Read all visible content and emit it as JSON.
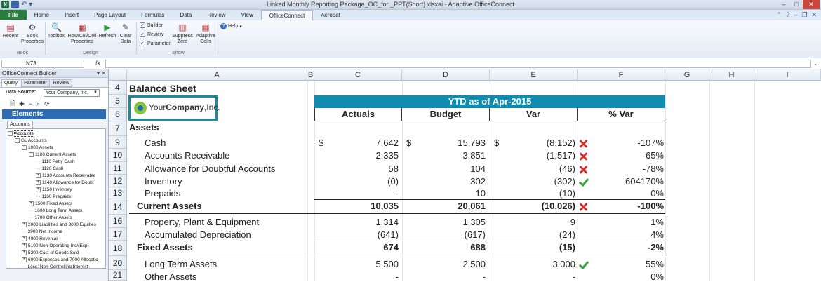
{
  "window": {
    "title": "Linked  Monthly Reporting Package_OC_for _PPT(Short).xlsxai - Adaptive OfficeConnect",
    "controls": [
      "–",
      "□",
      "✕"
    ]
  },
  "ribbon": {
    "tabs": [
      "File",
      "Home",
      "Insert",
      "Page Layout",
      "Formulas",
      "Data",
      "Review",
      "View",
      "OfficeConnect",
      "Acrobat"
    ],
    "active_tab": "OfficeConnect",
    "buttons": {
      "recent": "Recent",
      "book_properties": "Book Properties",
      "toolbox": "Toolbox",
      "rowcolcell": "Row/Col/Cell Properties",
      "refresh": "Refresh",
      "clear_data": "Clear Data",
      "suppress_zero": "Suppress Zero",
      "adaptive_cells": "Adaptive Cells",
      "help": "Help"
    },
    "checkboxes": {
      "builder": "Builder",
      "review": "Review",
      "parameter": "Parameter"
    },
    "groups": {
      "book": "Book",
      "design": "Design",
      "show": "Show"
    }
  },
  "formula_bar": {
    "name_box": "N73",
    "fx": "fx",
    "formula": ""
  },
  "pane": {
    "title": "OfficeConnect Builder",
    "tabs": [
      "Query",
      "Parameter",
      "Review"
    ],
    "data_source_label": "Data Source:",
    "data_source_value": "Your Company, Inc.",
    "elements_title": "Elements",
    "accounts_tab": "Accounts",
    "tree": [
      {
        "label": "Accounts",
        "level": 0,
        "toggle": "−"
      },
      {
        "label": "GL Accounts",
        "level": 1,
        "toggle": "−"
      },
      {
        "label": "1000 Assets",
        "level": 2,
        "toggle": "−"
      },
      {
        "label": "1100 Current Assets",
        "level": 3,
        "toggle": "−"
      },
      {
        "label": "1110 Petty Cash",
        "level": 4,
        "toggle": ""
      },
      {
        "label": "1120 Cash",
        "level": 4,
        "toggle": ""
      },
      {
        "label": "1130 Accounts Receivable",
        "level": 4,
        "toggle": "+"
      },
      {
        "label": "1140 Allowance for Doubt",
        "level": 4,
        "toggle": "+"
      },
      {
        "label": "1150 Inventory",
        "level": 4,
        "toggle": "+"
      },
      {
        "label": "1160 Prepaids",
        "level": 4,
        "toggle": ""
      },
      {
        "label": "1500 Fixed Assets",
        "level": 3,
        "toggle": "+"
      },
      {
        "label": "1600 Long Term Assets",
        "level": 3,
        "toggle": ""
      },
      {
        "label": "1700 Other Assets",
        "level": 3,
        "toggle": ""
      },
      {
        "label": "2000 Liabilities and 3000 Equities",
        "level": 2,
        "toggle": "+"
      },
      {
        "label": "3900 Net Income",
        "level": 2,
        "toggle": ""
      },
      {
        "label": "4000 Revenue",
        "level": 2,
        "toggle": "+"
      },
      {
        "label": "5100 Non-Operating Inc/(Exp)",
        "level": 2,
        "toggle": "+"
      },
      {
        "label": "5200 Cost of Goods Sold",
        "level": 2,
        "toggle": "+"
      },
      {
        "label": "6000 Expenses and 7000 Allocatic",
        "level": 2,
        "toggle": "+"
      },
      {
        "label": "Less: Non-Controlling Interest",
        "level": 2,
        "toggle": ""
      }
    ]
  },
  "sheet": {
    "columns": [
      "A",
      "B",
      "C",
      "D",
      "E",
      "F",
      "G",
      "H",
      "I"
    ],
    "rows": [
      "4",
      "5",
      "6",
      "7",
      "9",
      "10",
      "11",
      "12",
      "13",
      "14",
      "16",
      "17",
      "18",
      "20",
      "21"
    ],
    "title": "Balance Sheet",
    "logo_text_prefix": "Your",
    "logo_text_bold": "Company",
    "logo_text_suffix": ",Inc.",
    "period_header": "YTD as of Apr-2015",
    "col_headers": {
      "actuals": "Actuals",
      "budget": "Budget",
      "var": "Var",
      "pct_var": "% Var"
    },
    "section_assets": "Assets",
    "currency": "$",
    "lines": [
      {
        "label": "Cash",
        "actuals": "7,642",
        "budget": "15,793",
        "var": "(8,152)",
        "pct": "-107%",
        "flag": "x",
        "dollar": true
      },
      {
        "label": "Accounts Receivable",
        "actuals": "2,335",
        "budget": "3,851",
        "var": "(1,517)",
        "pct": "-65%",
        "flag": "x"
      },
      {
        "label": "Allowance for Doubtful Accounts",
        "actuals": "58",
        "budget": "104",
        "var": "(46)",
        "pct": "-78%",
        "flag": "x"
      },
      {
        "label": "Inventory",
        "actuals": "(0)",
        "budget": "302",
        "var": "(302)",
        "pct": "604170%",
        "flag": "check"
      },
      {
        "label": "Prepaids",
        "actuals": "-",
        "budget": "10",
        "var": "(10)",
        "pct": "0%",
        "flag": ""
      },
      {
        "label": "Current Assets",
        "actuals": "10,035",
        "budget": "20,061",
        "var": "(10,026)",
        "pct": "-100%",
        "flag": "x",
        "total": true
      },
      {
        "label": "Property, Plant & Equipment",
        "actuals": "1,314",
        "budget": "1,305",
        "var": "9",
        "pct": "1%",
        "flag": ""
      },
      {
        "label": "Accumulated Depreciation",
        "actuals": "(641)",
        "budget": "(617)",
        "var": "(24)",
        "pct": "4%",
        "flag": ""
      },
      {
        "label": "Fixed Assets",
        "actuals": "674",
        "budget": "688",
        "var": "(15)",
        "pct": "-2%",
        "flag": "",
        "total": true
      },
      {
        "label": "Long Term Assets",
        "actuals": "5,500",
        "budget": "2,500",
        "var": "3,000",
        "pct": "55%",
        "flag": "check"
      },
      {
        "label": "Other Assets",
        "actuals": "-",
        "budget": "-",
        "var": "-",
        "pct": "0%",
        "flag": ""
      }
    ]
  }
}
